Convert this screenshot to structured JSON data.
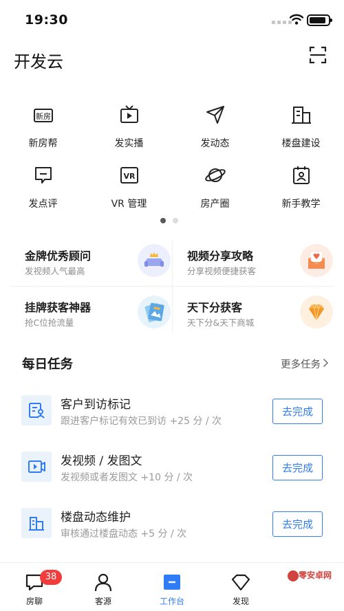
{
  "status_bar": {
    "time": "19:30"
  },
  "header": {
    "title": "开发云",
    "scan_icon": "scan-icon"
  },
  "features": [
    {
      "label": "新房帮",
      "icon": "new-house-icon"
    },
    {
      "label": "发实播",
      "icon": "live-tv-icon"
    },
    {
      "label": "发动态",
      "icon": "send-icon"
    },
    {
      "label": "楼盘建设",
      "icon": "building-icon"
    },
    {
      "label": "发点评",
      "icon": "comment-icon"
    },
    {
      "label": "VR 管理",
      "icon": "vr-icon"
    },
    {
      "label": "房产圈",
      "icon": "planet-icon"
    },
    {
      "label": "新手教学",
      "icon": "tutorial-icon"
    }
  ],
  "pager": {
    "current": 1,
    "total": 2
  },
  "promos": [
    {
      "title": "金牌优秀顾问",
      "subtitle": "发视频人气最高",
      "icon": "crown-sofa-icon"
    },
    {
      "title": "视频分享攻略",
      "subtitle": "分享视频便捷获客",
      "icon": "heart-envelope-icon"
    },
    {
      "title": "挂牌获客神器",
      "subtitle": "抢C位抢流量",
      "icon": "photo-card-icon"
    },
    {
      "title": "天下分获客",
      "subtitle": "天下分&天下商城",
      "icon": "diamond-icon"
    }
  ],
  "tasks": {
    "title": "每日任务",
    "more_label": "更多任务",
    "items": [
      {
        "title": "客户到访标记",
        "desc": "跟进客户标记有效已到访 +25 分 / 次",
        "button": "去完成",
        "icon": "visit-record-icon"
      },
      {
        "title": "发视频 / 发图文",
        "desc": "发视频或者发图文 +10 分 / 次",
        "button": "去完成",
        "icon": "video-post-icon"
      },
      {
        "title": "楼盘动态维护",
        "desc": "审核通过楼盘动态 +5 分 / 次",
        "button": "去完成",
        "icon": "building-update-icon"
      }
    ]
  },
  "tabs": [
    {
      "label": "房聊",
      "icon": "chat-icon",
      "badge": "38",
      "active": false
    },
    {
      "label": "客源",
      "icon": "person-icon",
      "active": false
    },
    {
      "label": "工作台",
      "icon": "workbench-icon",
      "active": true
    },
    {
      "label": "发现",
      "icon": "discover-icon",
      "active": false
    }
  ],
  "watermark": {
    "text": "零安卓网"
  },
  "colors": {
    "accent": "#2f7cf6",
    "badge": "#f23c3c",
    "icon_stroke": "#222222",
    "task_icon_bg": "#eaf2fc"
  }
}
